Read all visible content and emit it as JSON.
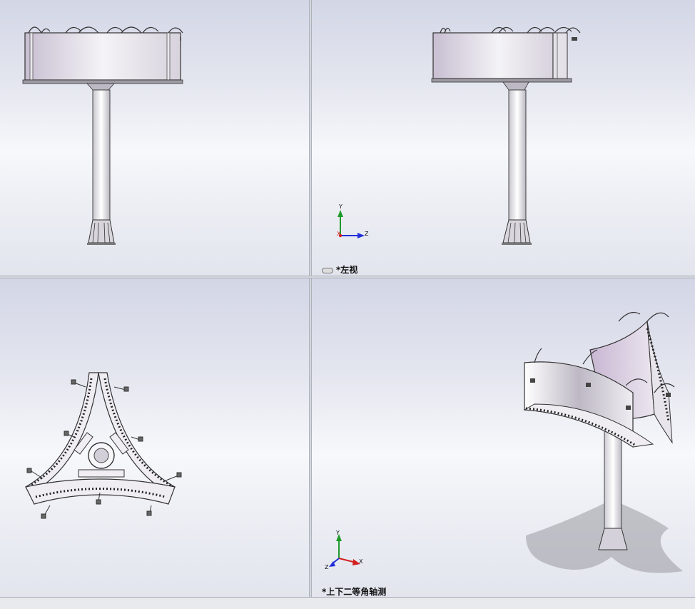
{
  "views": {
    "top_left": {
      "label": ""
    },
    "top_right": {
      "label": "*左视"
    },
    "bottom_left": {
      "label": ""
    },
    "bottom_right": {
      "label": "*上下二等角轴测"
    }
  },
  "triad": {
    "y": "Y",
    "x": "X",
    "z": "Z"
  },
  "colors": {
    "axis_x": "#d22020",
    "axis_y": "#1f9a2a",
    "axis_z": "#2230d8",
    "model_steel": "#c9c6cf",
    "panel_face": "#cfc3d6"
  }
}
